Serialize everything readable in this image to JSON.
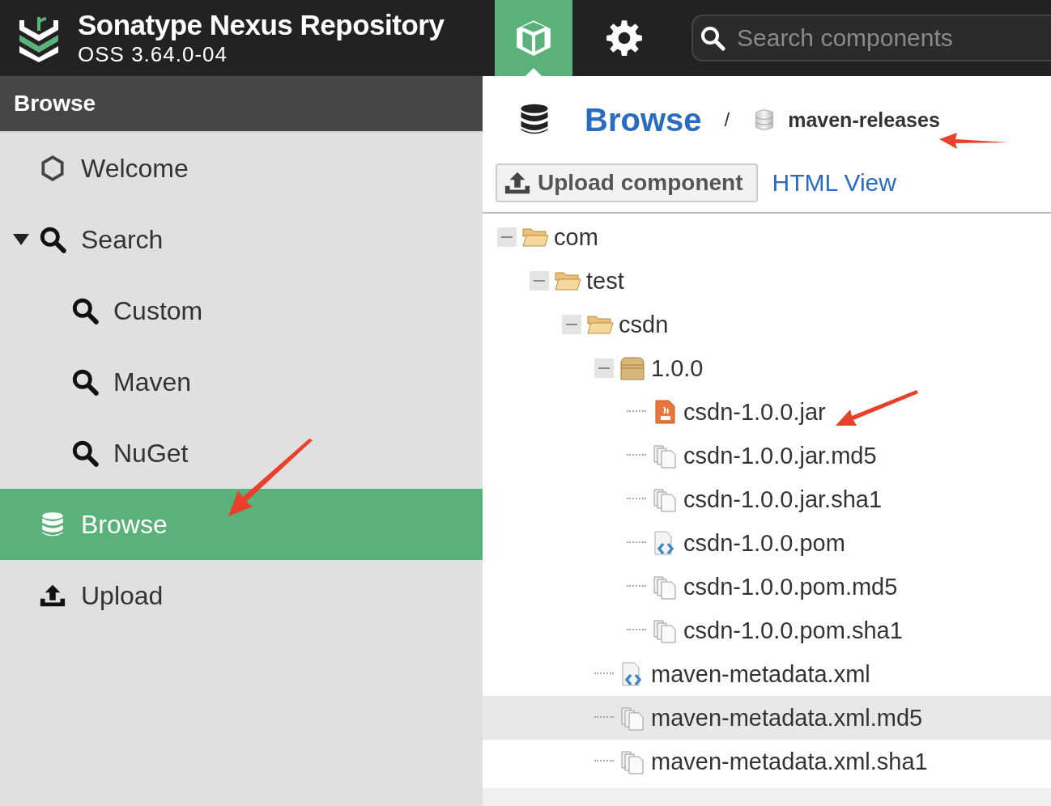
{
  "header": {
    "title": "Sonatype Nexus Repository",
    "version": "OSS 3.64.0-04",
    "modes": [
      {
        "kind": "browse",
        "selected": true
      },
      {
        "kind": "admin",
        "selected": false
      }
    ],
    "search": {
      "placeholder": "Search components"
    }
  },
  "sidebar": {
    "title": "Browse",
    "items": [
      {
        "label": "Welcome",
        "kind": "welcome",
        "selected": false
      },
      {
        "label": "Search",
        "kind": "search",
        "selected": false,
        "expanded": true,
        "children": [
          {
            "label": "Custom",
            "kind": "search",
            "selected": false
          },
          {
            "label": "Maven",
            "kind": "search",
            "selected": false
          },
          {
            "label": "NuGet",
            "kind": "search",
            "selected": false
          }
        ]
      },
      {
        "label": "Browse",
        "kind": "browse",
        "selected": true
      },
      {
        "label": "Upload",
        "kind": "upload",
        "selected": false
      }
    ]
  },
  "breadcrumb": {
    "title": "Browse",
    "separator": "/",
    "repository": "maven-releases"
  },
  "toolbar": {
    "upload_button": "Upload component",
    "html_view_link": "HTML View"
  },
  "tree": [
    {
      "label": "com",
      "kind": "folder",
      "expanded": true,
      "selected": false,
      "children": [
        {
          "label": "test",
          "kind": "folder",
          "expanded": true,
          "selected": false,
          "children": [
            {
              "label": "csdn",
              "kind": "folder",
              "expanded": true,
              "selected": false,
              "children": [
                {
                  "label": "1.0.0",
                  "kind": "component",
                  "expanded": true,
                  "selected": false,
                  "children": [
                    {
                      "label": "csdn-1.0.0.jar",
                      "kind": "jar",
                      "selected": false
                    },
                    {
                      "label": "csdn-1.0.0.jar.md5",
                      "kind": "checksum",
                      "selected": false
                    },
                    {
                      "label": "csdn-1.0.0.jar.sha1",
                      "kind": "checksum",
                      "selected": false
                    },
                    {
                      "label": "csdn-1.0.0.pom",
                      "kind": "xml",
                      "selected": false
                    },
                    {
                      "label": "csdn-1.0.0.pom.md5",
                      "kind": "checksum",
                      "selected": false
                    },
                    {
                      "label": "csdn-1.0.0.pom.sha1",
                      "kind": "checksum",
                      "selected": false
                    }
                  ]
                },
                {
                  "label": "maven-metadata.xml",
                  "kind": "xml",
                  "selected": false
                },
                {
                  "label": "maven-metadata.xml.md5",
                  "kind": "checksum",
                  "selected": true
                },
                {
                  "label": "maven-metadata.xml.sha1",
                  "kind": "checksum",
                  "selected": false
                }
              ]
            }
          ]
        }
      ]
    }
  ]
}
